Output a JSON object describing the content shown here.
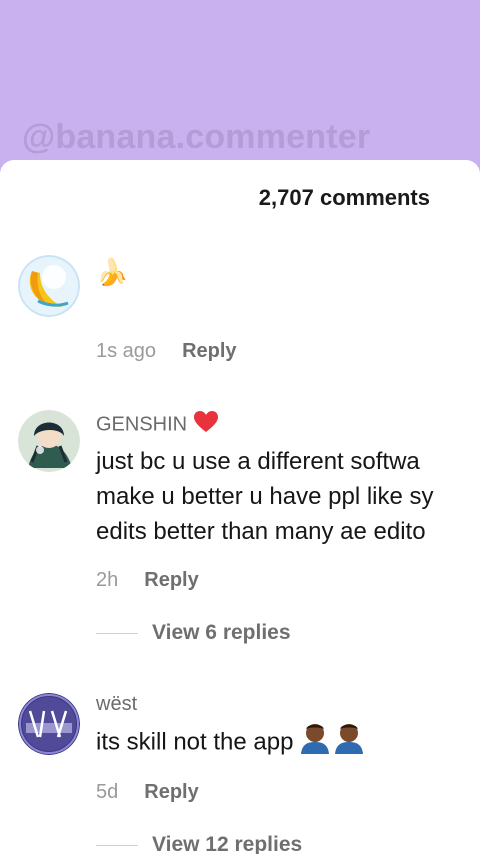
{
  "watermark": "@banana.commenter",
  "comments_count": "2,707 comments",
  "comments": [
    {
      "username": "",
      "text": "🍌",
      "time": "1s ago",
      "reply": "Reply"
    },
    {
      "username": "GENSHIN",
      "username_emoji": "heart-icon",
      "text_lines": [
        "just bc u use a different softwa",
        "make u better u have ppl like sy",
        "edits better than many ae edito"
      ],
      "time": "2h",
      "reply": "Reply",
      "view_replies": "View 6 replies"
    },
    {
      "username": "wëst",
      "text": "its skill not the app",
      "text_emoji": "person-emoji",
      "time": "5d",
      "reply": "Reply",
      "view_replies": "View 12 replies"
    }
  ],
  "colors": {
    "header_bg": "#c9b0ef",
    "watermark": "#b39dd6",
    "sheet_bg": "#ffffff"
  }
}
